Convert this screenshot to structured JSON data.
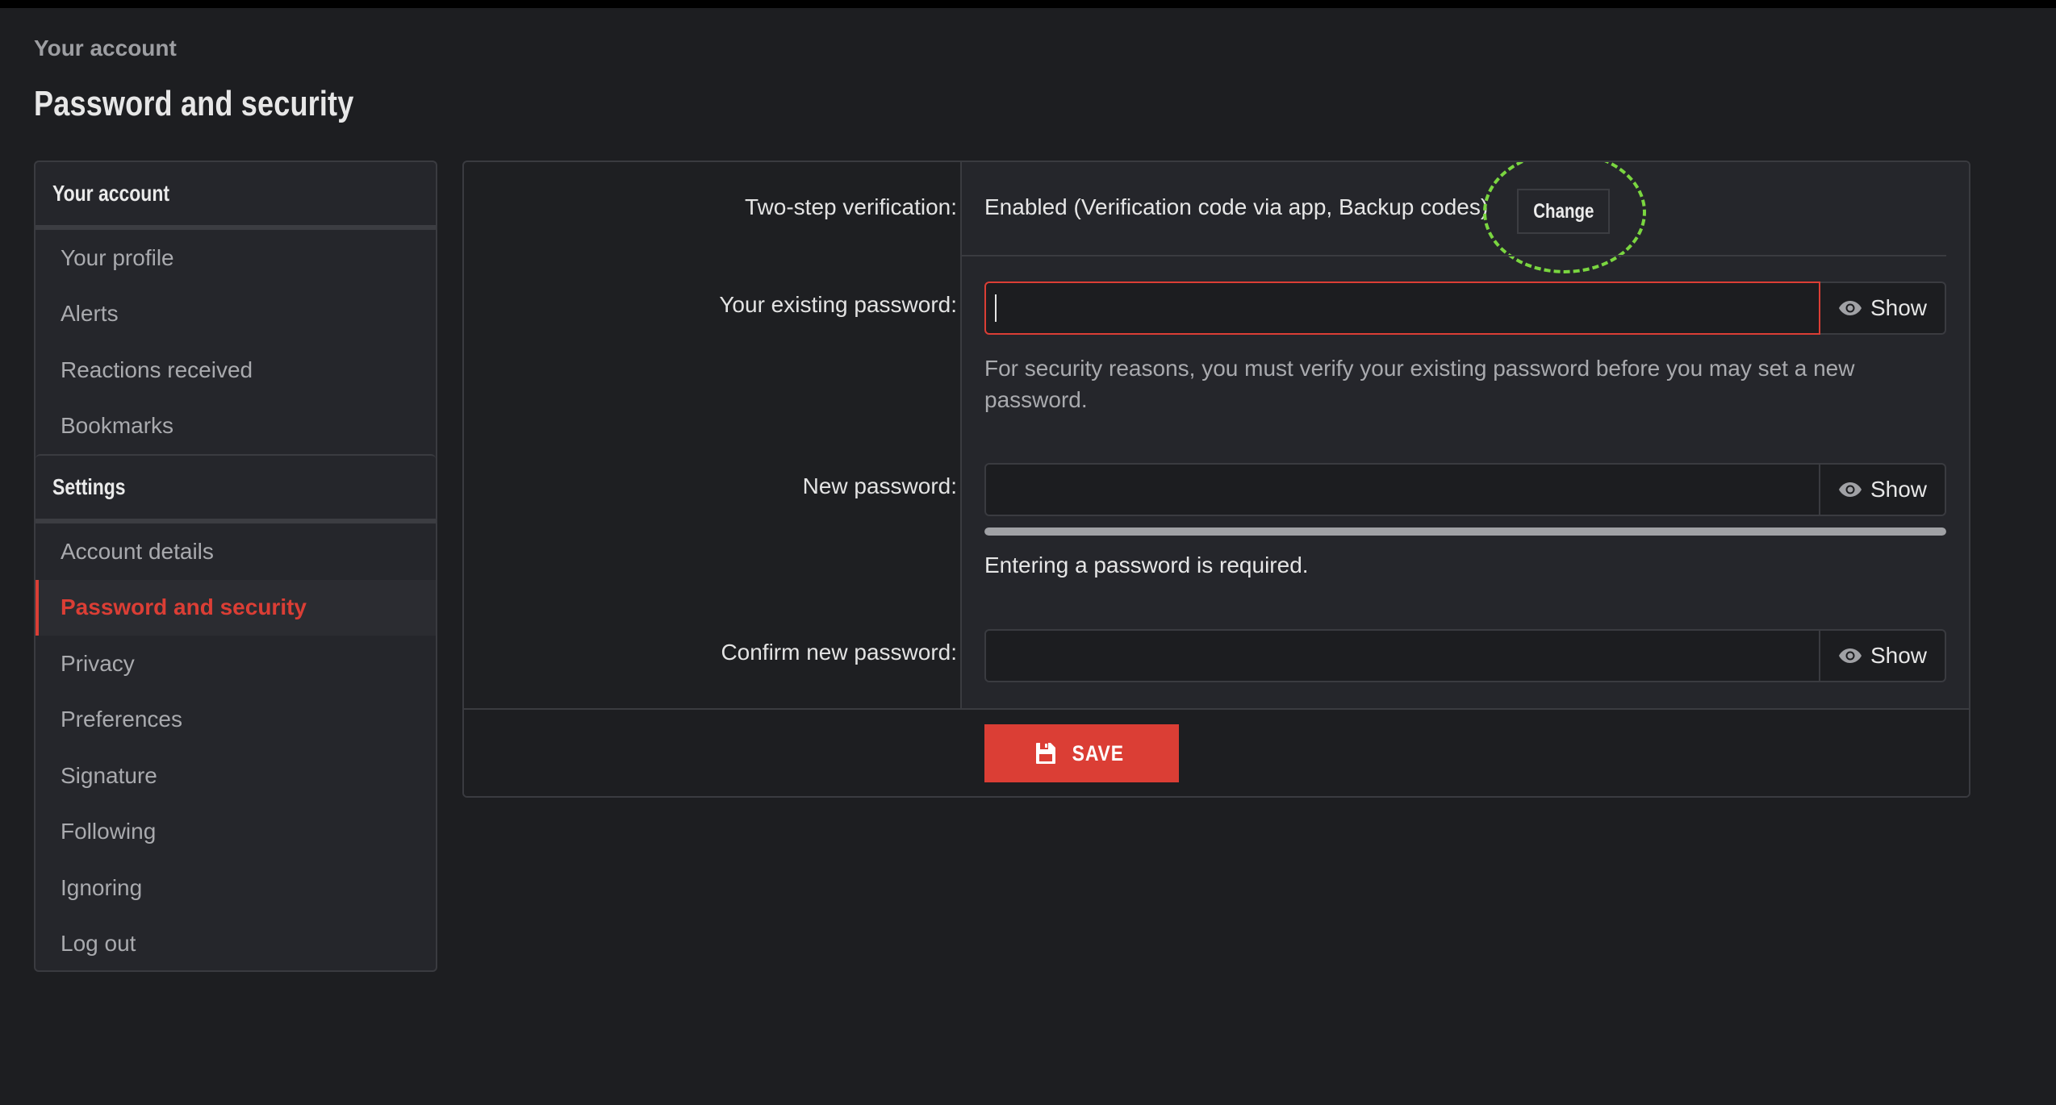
{
  "breadcrumb": "Your account",
  "page_title": "Password and security",
  "sidebar": {
    "groups": [
      {
        "heading": "Your account",
        "items": [
          {
            "label": "Your profile",
            "active": false
          },
          {
            "label": "Alerts",
            "active": false
          },
          {
            "label": "Reactions received",
            "active": false
          },
          {
            "label": "Bookmarks",
            "active": false
          }
        ]
      },
      {
        "heading": "Settings",
        "items": [
          {
            "label": "Account details",
            "active": false
          },
          {
            "label": "Password and security",
            "active": true
          },
          {
            "label": "Privacy",
            "active": false
          },
          {
            "label": "Preferences",
            "active": false
          },
          {
            "label": "Signature",
            "active": false
          },
          {
            "label": "Following",
            "active": false
          },
          {
            "label": "Ignoring",
            "active": false
          },
          {
            "label": "Log out",
            "active": false
          }
        ]
      }
    ]
  },
  "form": {
    "two_step": {
      "label": "Two-step verification:",
      "status": "Enabled (Verification code via app, Backup codes)",
      "change_label": "Change"
    },
    "existing_password": {
      "label": "Your existing password:",
      "value": "",
      "show_label": "Show",
      "help": "For security reasons, you must verify your existing password before you may set a new password."
    },
    "new_password": {
      "label": "New password:",
      "value": "",
      "show_label": "Show",
      "strength_percent": 0,
      "strength_message": "Entering a password is required."
    },
    "confirm_password": {
      "label": "Confirm new password:",
      "value": "",
      "show_label": "Show"
    },
    "save_label": "SAVE"
  },
  "colors": {
    "accent": "#db3e35",
    "highlight_ring": "#7ad640",
    "background": "#1d1e21",
    "panel": "#25262b"
  }
}
